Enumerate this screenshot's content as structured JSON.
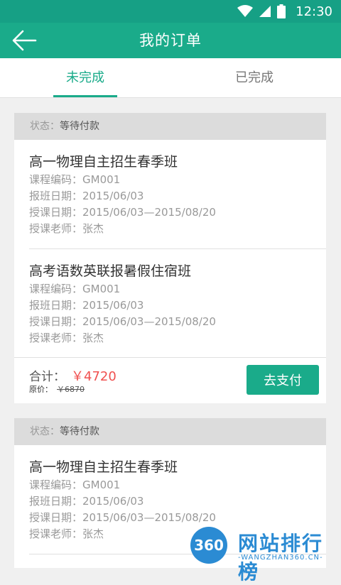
{
  "status_bar": {
    "time": "12:30"
  },
  "app_bar": {
    "title": "我的订单"
  },
  "tabs": [
    {
      "label": "未完成",
      "active": true
    },
    {
      "label": "已完成",
      "active": false
    }
  ],
  "orders": [
    {
      "status_label": "状态：",
      "status_value": "等待付款",
      "courses": [
        {
          "title": "高一物理自主招生春季班",
          "code_label": "课程编码：",
          "code": "GM001",
          "enroll_label": "报班日期：",
          "enroll_date": "2015/06/03",
          "period_label": "授课日期：",
          "period": "2015/06/03—2015/08/20",
          "teacher_label": "授课老师：",
          "teacher": "张杰"
        },
        {
          "title": "高考语数英联报暑假住宿班",
          "code_label": "课程编码：",
          "code": "GM001",
          "enroll_label": "报班日期：",
          "enroll_date": "2015/06/03",
          "period_label": "授课日期：",
          "period": "2015/06/03—2015/08/20",
          "teacher_label": "授课老师：",
          "teacher": "张杰"
        }
      ],
      "total_label": "合计：",
      "total": "￥4720",
      "original_label": "原价：",
      "original": "￥6870",
      "pay_label": "去支付"
    },
    {
      "status_label": "状态：",
      "status_value": "等待付款",
      "courses": [
        {
          "title": "高一物理自主招生春季班",
          "code_label": "课程编码：",
          "code": "GM001",
          "enroll_label": "报班日期：",
          "enroll_date": "2015/06/03",
          "period_label": "授课日期：",
          "period": "2015/06/03—2015/08/20",
          "teacher_label": "授课老师：",
          "teacher": "张杰"
        }
      ]
    }
  ],
  "watermark": {
    "badge": "360",
    "name": "网站排行榜",
    "url": "-WANGZHAN360.CN-"
  },
  "colors": {
    "primary": "#1aab8a",
    "status_bar": "#16a085",
    "price": "#f0504f"
  }
}
